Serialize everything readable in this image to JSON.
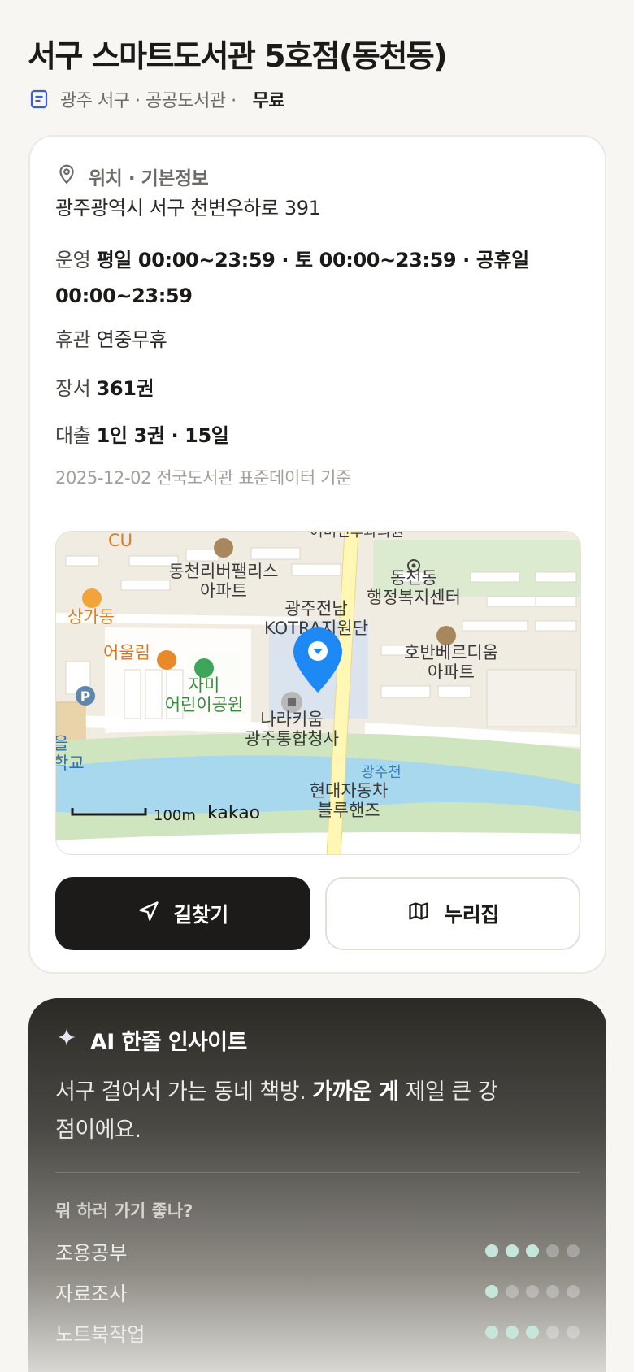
{
  "header": {
    "title": "서구 스마트도서관 5호점(동천동)",
    "meta": "광주 서구 · 공공도서관 ·",
    "fee": "무료"
  },
  "info": {
    "heading": "위치 · 기본정보",
    "address": "광주광역시 서구 천변우하로 391",
    "hours_label": "운영",
    "hours_value": "평일 00:00~23:59 · 토 00:00~23:59 · 공휴일 00:00~23:59",
    "closed_label": "휴관",
    "closed_value": "연중무휴",
    "books_label": "장서",
    "books_value": "361권",
    "loan_label": "대출",
    "loan_value": "1인 3권 · 15일",
    "basis": "2025-12-02 전국도서관 표준데이터 기준"
  },
  "map": {
    "labels": {
      "cu": "CU",
      "sangga": "상가동",
      "eoullim": "어울림",
      "jami1": "자미",
      "jami2": "어린이공원",
      "riverpalace1": "동천리버팰리스",
      "riverpalace2": "아파트",
      "kotra1": "광주전남",
      "kotra2": "KOTRA지원단",
      "naraki1": "나라키움",
      "naraki2": "광주통합청사",
      "dongcheon1": "동천동",
      "dongcheon2": "행정복지센터",
      "hoban1": "호반베르디움",
      "hoban2": "아파트",
      "river": "광주천",
      "hyundai1": "현대자동차",
      "hyundai2": "블루핸즈",
      "school1": "을",
      "school2": "학교",
      "top": "어미인후과의원",
      "scale": "100m",
      "brand": "kakao"
    },
    "colors": {
      "pin": "#1e88f5",
      "water": "#a8d8ee",
      "park": "#cfe5bf",
      "road": "#fff7b3"
    }
  },
  "buttons": {
    "directions": "길찾기",
    "nurijip": "누리집"
  },
  "ai": {
    "heading": "AI 한줄 인사이트",
    "text_pre": "서구 걸어서 가는 동네 책방. ",
    "text_bold": "가까운 게",
    "text_post": " 제일 큰 강점이에요.",
    "question": "뭐 하러 가기 좋나?",
    "activities": [
      {
        "label": "조용공부",
        "rating": 3,
        "max": 5
      },
      {
        "label": "자료조사",
        "rating": 1,
        "max": 5
      },
      {
        "label": "노트북작업",
        "rating": 3,
        "max": 5
      }
    ]
  }
}
